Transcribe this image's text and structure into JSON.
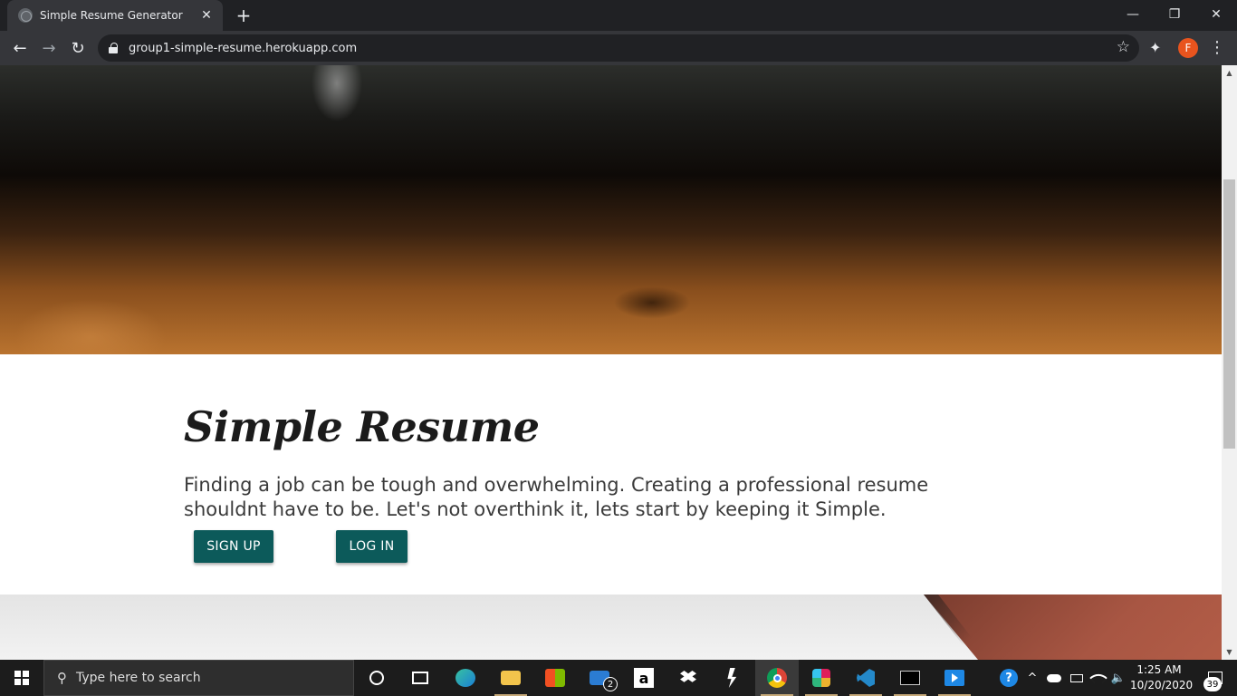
{
  "browser": {
    "tab_title": "Simple Resume Generator",
    "tab_close": "✕",
    "new_tab": "+",
    "window_controls": {
      "minimize": "—",
      "restore": "❐",
      "close": "✕"
    },
    "nav": {
      "back": "←",
      "forward": "→",
      "reload": "↻"
    },
    "url": "group1-simple-resume.herokuapp.com",
    "bookmark_icon": "☆",
    "extensions_icon": "✦",
    "profile_initial": "F",
    "menu_icon": "⋮"
  },
  "page": {
    "title": "Simple Resume",
    "tagline": "Finding a job can be tough and overwhelming. Creating a professional resume shouldnt have to be. Let's not overthink it, lets start by keeping it Simple.",
    "buttons": {
      "signup": "SIGN UP",
      "login": "LOG IN"
    },
    "button_color": "#0c5a5a"
  },
  "scrollbar": {
    "up": "▲",
    "down": "▼"
  },
  "taskbar": {
    "search_placeholder": "Type here to search",
    "search_icon": "⚲",
    "mail_badge": "2",
    "amazon_label": "a",
    "help_icon": "?",
    "tray_chevron": "^",
    "volume_icon": "🔈",
    "time": "1:25 AM",
    "date": "10/20/2020",
    "notification_count": "39"
  }
}
